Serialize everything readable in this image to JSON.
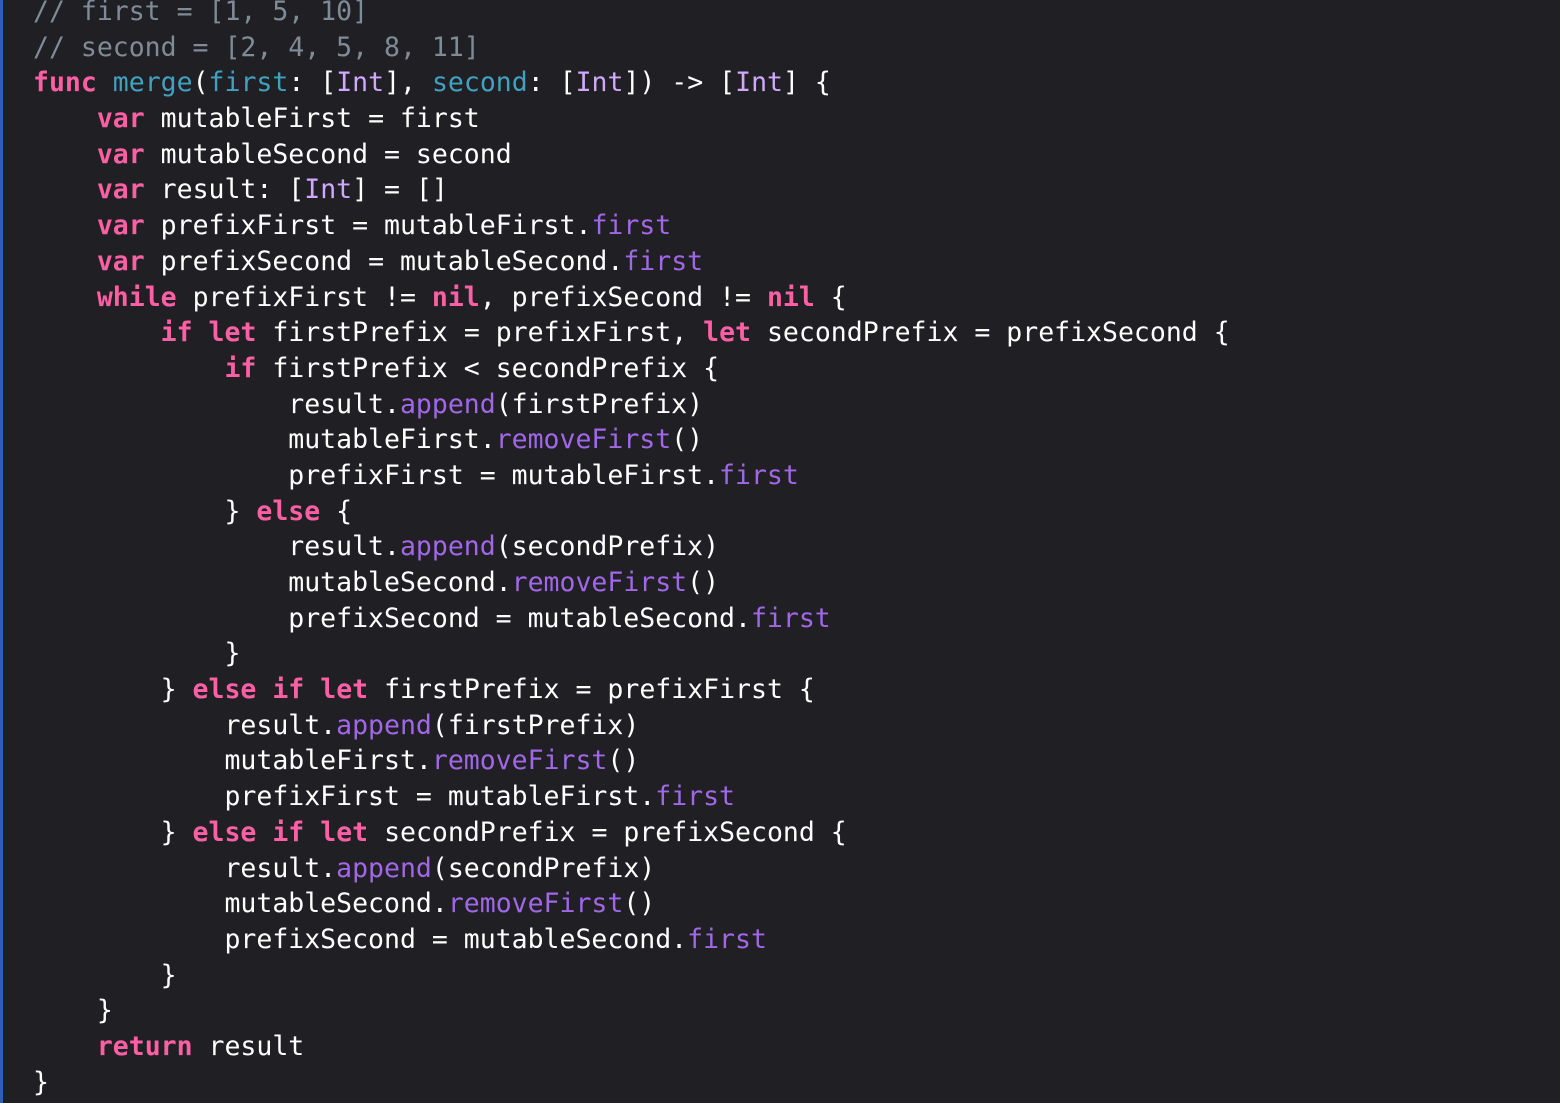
{
  "editor": {
    "language": "Swift",
    "colors": {
      "background": "#1f1f24",
      "plain": "#ffffff",
      "comment": "#7f8c98",
      "keyword": "#fc5fa3",
      "declaration": "#41a1c0",
      "type": "#d0a8ff",
      "member": "#a167e6",
      "gutter_accent": "#2f5fb8"
    },
    "lines": [
      [
        {
          "k": "comment",
          "t": "// first = [1, 5, 10]"
        }
      ],
      [
        {
          "k": "comment",
          "t": "// second = [2, 4, 5, 8, 11]"
        }
      ],
      [
        {
          "k": "keyword",
          "t": "func"
        },
        {
          "k": "plain",
          "t": " "
        },
        {
          "k": "decl",
          "t": "merge"
        },
        {
          "k": "plain",
          "t": "("
        },
        {
          "k": "decl",
          "t": "first"
        },
        {
          "k": "plain",
          "t": ": ["
        },
        {
          "k": "type",
          "t": "Int"
        },
        {
          "k": "plain",
          "t": "], "
        },
        {
          "k": "decl",
          "t": "second"
        },
        {
          "k": "plain",
          "t": ": ["
        },
        {
          "k": "type",
          "t": "Int"
        },
        {
          "k": "plain",
          "t": "]) -> ["
        },
        {
          "k": "type",
          "t": "Int"
        },
        {
          "k": "plain",
          "t": "] {"
        }
      ],
      [
        {
          "k": "plain",
          "t": "    "
        },
        {
          "k": "keyword",
          "t": "var"
        },
        {
          "k": "plain",
          "t": " mutableFirst = first"
        }
      ],
      [
        {
          "k": "plain",
          "t": "    "
        },
        {
          "k": "keyword",
          "t": "var"
        },
        {
          "k": "plain",
          "t": " mutableSecond = second"
        }
      ],
      [
        {
          "k": "plain",
          "t": "    "
        },
        {
          "k": "keyword",
          "t": "var"
        },
        {
          "k": "plain",
          "t": " result: ["
        },
        {
          "k": "type",
          "t": "Int"
        },
        {
          "k": "plain",
          "t": "] = []"
        }
      ],
      [
        {
          "k": "plain",
          "t": "    "
        },
        {
          "k": "keyword",
          "t": "var"
        },
        {
          "k": "plain",
          "t": " prefixFirst = mutableFirst."
        },
        {
          "k": "member",
          "t": "first"
        }
      ],
      [
        {
          "k": "plain",
          "t": "    "
        },
        {
          "k": "keyword",
          "t": "var"
        },
        {
          "k": "plain",
          "t": " prefixSecond = mutableSecond."
        },
        {
          "k": "member",
          "t": "first"
        }
      ],
      [
        {
          "k": "plain",
          "t": "    "
        },
        {
          "k": "keyword",
          "t": "while"
        },
        {
          "k": "plain",
          "t": " prefixFirst != "
        },
        {
          "k": "keyword",
          "t": "nil"
        },
        {
          "k": "plain",
          "t": ", prefixSecond != "
        },
        {
          "k": "keyword",
          "t": "nil"
        },
        {
          "k": "plain",
          "t": " {"
        }
      ],
      [
        {
          "k": "plain",
          "t": "        "
        },
        {
          "k": "keyword",
          "t": "if"
        },
        {
          "k": "plain",
          "t": " "
        },
        {
          "k": "keyword",
          "t": "let"
        },
        {
          "k": "plain",
          "t": " firstPrefix = prefixFirst, "
        },
        {
          "k": "keyword",
          "t": "let"
        },
        {
          "k": "plain",
          "t": " secondPrefix = prefixSecond {"
        }
      ],
      [
        {
          "k": "plain",
          "t": "            "
        },
        {
          "k": "keyword",
          "t": "if"
        },
        {
          "k": "plain",
          "t": " firstPrefix < secondPrefix {"
        }
      ],
      [
        {
          "k": "plain",
          "t": "                result."
        },
        {
          "k": "member",
          "t": "append"
        },
        {
          "k": "plain",
          "t": "(firstPrefix)"
        }
      ],
      [
        {
          "k": "plain",
          "t": "                mutableFirst."
        },
        {
          "k": "member",
          "t": "removeFirst"
        },
        {
          "k": "plain",
          "t": "()"
        }
      ],
      [
        {
          "k": "plain",
          "t": "                prefixFirst = mutableFirst."
        },
        {
          "k": "member",
          "t": "first"
        }
      ],
      [
        {
          "k": "plain",
          "t": "            } "
        },
        {
          "k": "keyword",
          "t": "else"
        },
        {
          "k": "plain",
          "t": " {"
        }
      ],
      [
        {
          "k": "plain",
          "t": "                result."
        },
        {
          "k": "member",
          "t": "append"
        },
        {
          "k": "plain",
          "t": "(secondPrefix)"
        }
      ],
      [
        {
          "k": "plain",
          "t": "                mutableSecond."
        },
        {
          "k": "member",
          "t": "removeFirst"
        },
        {
          "k": "plain",
          "t": "()"
        }
      ],
      [
        {
          "k": "plain",
          "t": "                prefixSecond = mutableSecond."
        },
        {
          "k": "member",
          "t": "first"
        }
      ],
      [
        {
          "k": "plain",
          "t": "            }"
        }
      ],
      [
        {
          "k": "plain",
          "t": "        } "
        },
        {
          "k": "keyword",
          "t": "else"
        },
        {
          "k": "plain",
          "t": " "
        },
        {
          "k": "keyword",
          "t": "if"
        },
        {
          "k": "plain",
          "t": " "
        },
        {
          "k": "keyword",
          "t": "let"
        },
        {
          "k": "plain",
          "t": " firstPrefix = prefixFirst {"
        }
      ],
      [
        {
          "k": "plain",
          "t": "            result."
        },
        {
          "k": "member",
          "t": "append"
        },
        {
          "k": "plain",
          "t": "(firstPrefix)"
        }
      ],
      [
        {
          "k": "plain",
          "t": "            mutableFirst."
        },
        {
          "k": "member",
          "t": "removeFirst"
        },
        {
          "k": "plain",
          "t": "()"
        }
      ],
      [
        {
          "k": "plain",
          "t": "            prefixFirst = mutableFirst."
        },
        {
          "k": "member",
          "t": "first"
        }
      ],
      [
        {
          "k": "plain",
          "t": "        } "
        },
        {
          "k": "keyword",
          "t": "else"
        },
        {
          "k": "plain",
          "t": " "
        },
        {
          "k": "keyword",
          "t": "if"
        },
        {
          "k": "plain",
          "t": " "
        },
        {
          "k": "keyword",
          "t": "let"
        },
        {
          "k": "plain",
          "t": " secondPrefix = prefixSecond {"
        }
      ],
      [
        {
          "k": "plain",
          "t": "            result."
        },
        {
          "k": "member",
          "t": "append"
        },
        {
          "k": "plain",
          "t": "(secondPrefix)"
        }
      ],
      [
        {
          "k": "plain",
          "t": "            mutableSecond."
        },
        {
          "k": "member",
          "t": "removeFirst"
        },
        {
          "k": "plain",
          "t": "()"
        }
      ],
      [
        {
          "k": "plain",
          "t": "            prefixSecond = mutableSecond."
        },
        {
          "k": "member",
          "t": "first"
        }
      ],
      [
        {
          "k": "plain",
          "t": "        }"
        }
      ],
      [
        {
          "k": "plain",
          "t": "    }"
        }
      ],
      [
        {
          "k": "plain",
          "t": "    "
        },
        {
          "k": "keyword",
          "t": "return"
        },
        {
          "k": "plain",
          "t": " result"
        }
      ],
      [
        {
          "k": "plain",
          "t": "}"
        }
      ]
    ]
  }
}
